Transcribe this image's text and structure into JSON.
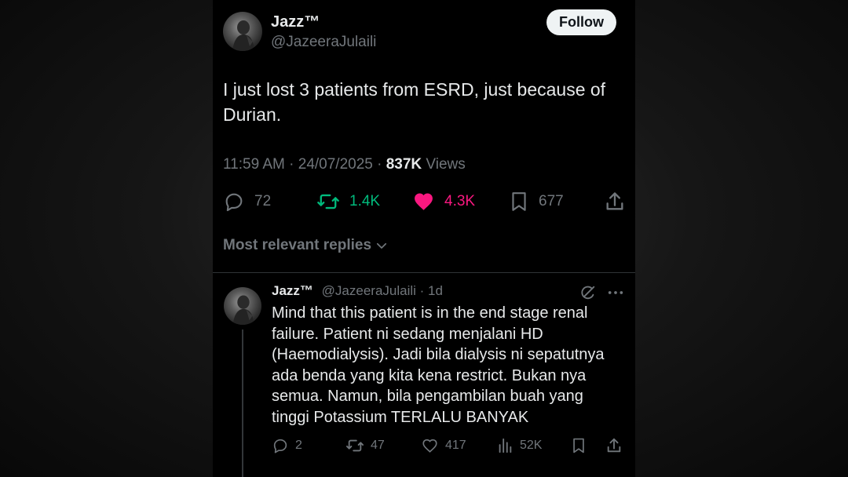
{
  "tweet": {
    "author_name": "Jazz™",
    "author_handle": "@JazeeraJulaili",
    "follow_label": "Follow",
    "text": "I just lost 3 patients from ESRD, just because of Durian.",
    "time": "11:59 AM · 24/07/2025 · ",
    "views_count": "837K",
    "views_label": " Views",
    "replies": "72",
    "reposts": "1.4K",
    "likes": "4.3K",
    "bookmarks": "677",
    "colors": {
      "repost": "#00ba7c",
      "like": "#f91880",
      "muted": "#71767b"
    }
  },
  "replies_filter": {
    "label": "Most relevant replies"
  },
  "reply": {
    "author_name": "Jazz™",
    "author_handle": "@JazeeraJulaili",
    "separator": " · ",
    "age": "1d",
    "text": "Mind that this patient is in the end stage renal failure. Patient ni sedang menjalani HD (Haemodialysis). Jadi bila dialysis ni sepatutnya ada benda yang kita kena restrict. Bukan nya semua. Namun, bila pengambilan buah yang tinggi Potassium TERLALU BANYAK",
    "replies": "2",
    "reposts": "47",
    "likes": "417",
    "views": "52K"
  }
}
